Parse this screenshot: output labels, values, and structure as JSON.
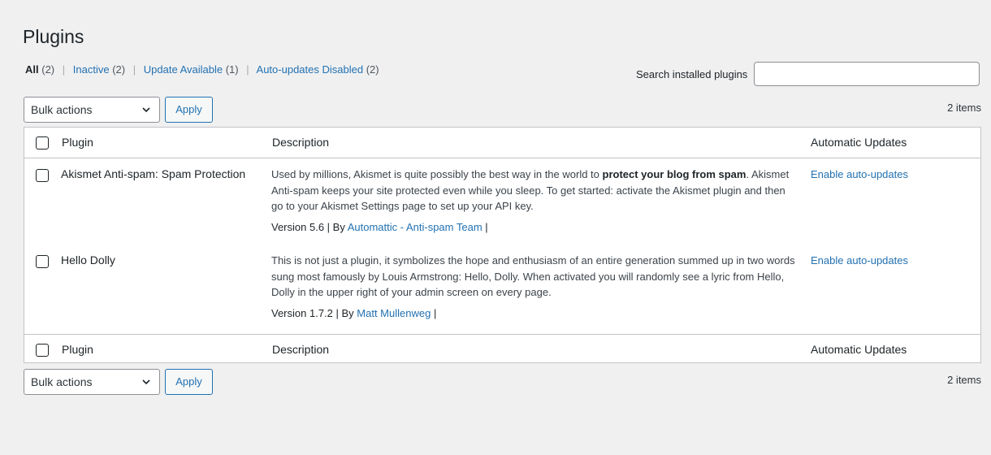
{
  "page": {
    "title": "Plugins"
  },
  "filters": [
    {
      "label": "All",
      "count": "(2)"
    },
    {
      "label": "Inactive",
      "count": "(2)"
    },
    {
      "label": "Update Available",
      "count": "(1)"
    },
    {
      "label": "Auto-updates Disabled",
      "count": "(2)"
    }
  ],
  "search": {
    "label": "Search installed plugins",
    "value": ""
  },
  "toolbar": {
    "bulk_label": "Bulk actions",
    "apply_label": "Apply",
    "items_count": "2 items"
  },
  "table": {
    "columns": {
      "plugin": "Plugin",
      "description": "Description",
      "auto": "Automatic Updates"
    },
    "rows": [
      {
        "name": "Akismet Anti-spam: Spam Protection",
        "desc_before": "Used by millions, Akismet is quite possibly the best way in the world to ",
        "desc_bold": "protect your blog from spam",
        "desc_after": ". Akismet Anti-spam keeps your site protected even while you sleep. To get started: activate the Akismet plugin and then go to your Akismet Settings page to set up your API key.",
        "version": "Version 5.6 | By ",
        "author": "Automattic - Anti-spam Team",
        "after_author": " |",
        "auto_link": "Enable auto-updates"
      },
      {
        "name": "Hello Dolly",
        "desc_before": "This is not just a plugin, it symbolizes the hope and enthusiasm of an entire generation summed up in two words sung most famously by Louis Armstrong: Hello, Dolly. When activated you will randomly see a lyric from Hello, Dolly in the upper right of your admin screen on every page.",
        "version": "Version 1.7.2 | By ",
        "author": "Matt Mullenweg",
        "after_author": " |",
        "auto_link": "Enable auto-updates"
      }
    ]
  },
  "colors": {
    "link": "#2271b1",
    "text": "#1d2327",
    "background": "#f0f0f1",
    "border": "#c3c4c7"
  },
  "icons": {
    "select_arrow": "chevron-down-icon"
  }
}
